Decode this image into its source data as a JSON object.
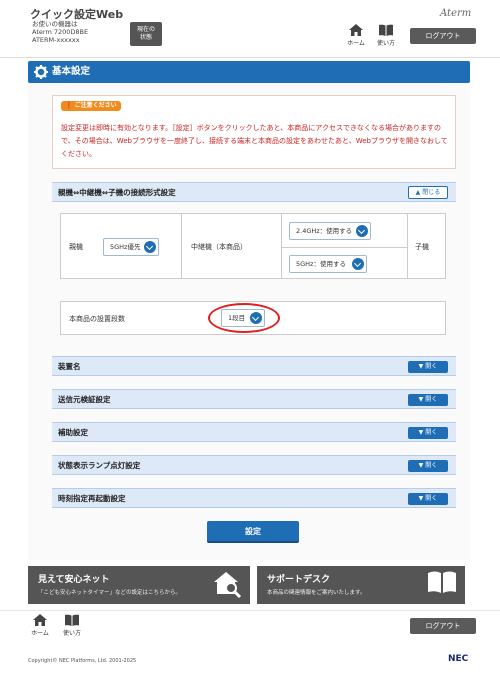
{
  "header": {
    "app_title": "クイック設定Web",
    "device_label": "お使いの機器は",
    "device_model": "Aterm 7200D8BE",
    "device_id": "ATERM-xxxxxx",
    "status_button": "現在の\n状態",
    "brand": "Aterm",
    "home_label": "ホーム",
    "manual_label": "使い方",
    "logout_label": "ログアウト"
  },
  "page": {
    "title": "基本設定"
  },
  "notice": {
    "tag": "ご注意ください",
    "text": "設定変更は即時に有効となります。［設定］ボタンをクリックしたあと、本商品にアクセスできなくなる場合がありますので、その場合は、Webブラウザを一度終了し、接続する端末と本商品の設定をあわせたあと、Webブラウザを開きなおしてください。"
  },
  "connection_section": {
    "title": "親機⇔中継機⇔子機の接続形式設定",
    "toggle_label": "閉じる",
    "parent_label": "親機",
    "parent_value": "5GHz優先",
    "repeater_label": "中継機（本商品）",
    "band_24_value": "2.4GHz：使用する",
    "band_5_value": "5GHz：使用する",
    "child_label": "子機"
  },
  "stage": {
    "label": "本商品の設置段数",
    "value": "1段目"
  },
  "sections": [
    {
      "title": "装置名",
      "toggle": "開く"
    },
    {
      "title": "送信元検証設定",
      "toggle": "開く"
    },
    {
      "title": "補助設定",
      "toggle": "開く"
    },
    {
      "title": "状態表示ランプ点灯設定",
      "toggle": "開く"
    },
    {
      "title": "時刻指定再起動設定",
      "toggle": "開く"
    }
  ],
  "apply_button": "設定",
  "banners": {
    "safety": {
      "title": "見えて安心ネット",
      "subtitle": "「こども安心ネットタイマー」などの設定はこちらから。"
    },
    "support": {
      "title": "サポートデスク",
      "subtitle": "本商品の関連情報をご案内いたします。"
    }
  },
  "footer": {
    "home_label": "ホーム",
    "manual_label": "使い方",
    "logout_label": "ログアウト",
    "copyright": "Copyright© NEC Platforms, Ltd. 2001-2025",
    "nec_logo": "NEC"
  },
  "colors": {
    "accent": "#1f6db5",
    "notice_text": "#cc2222",
    "notice_tag": "#f08c1e",
    "highlight_ring": "#e02020"
  }
}
